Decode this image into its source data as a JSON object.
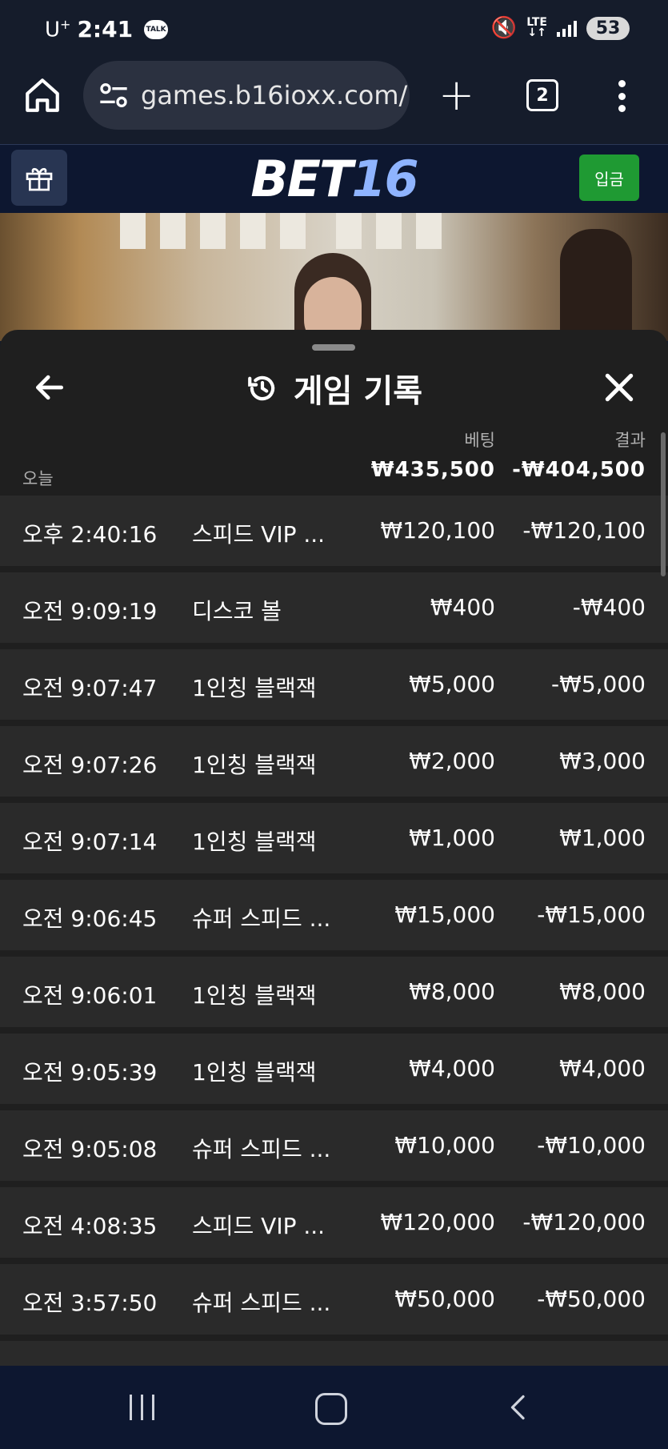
{
  "status_bar": {
    "carrier": "U",
    "carrier_sup": "+",
    "time": "2:41",
    "talk_badge": "TALK",
    "network": "LTE",
    "battery": "53"
  },
  "browser": {
    "url": "games.b16ioxx.com/",
    "tab_count": "2"
  },
  "site": {
    "logo_part1": "BET",
    "logo_part2": "16",
    "deposit_label": "입금"
  },
  "history": {
    "title": "게임 기록",
    "col_bet": "베팅",
    "col_result": "결과",
    "day_label": "오늘",
    "total_bet": "₩435,500",
    "total_result": "-₩404,500",
    "rows": [
      {
        "time": "오후 2:40:16",
        "game": "스피드 VIP ...",
        "bet": "₩120,100",
        "result": "-₩120,100"
      },
      {
        "time": "오전 9:09:19",
        "game": "디스코 볼",
        "bet": "₩400",
        "result": "-₩400"
      },
      {
        "time": "오전 9:07:47",
        "game": "1인칭 블랙잭",
        "bet": "₩5,000",
        "result": "-₩5,000"
      },
      {
        "time": "오전 9:07:26",
        "game": "1인칭 블랙잭",
        "bet": "₩2,000",
        "result": "₩3,000"
      },
      {
        "time": "오전 9:07:14",
        "game": "1인칭 블랙잭",
        "bet": "₩1,000",
        "result": "₩1,000"
      },
      {
        "time": "오전 9:06:45",
        "game": "슈퍼 스피드 ...",
        "bet": "₩15,000",
        "result": "-₩15,000"
      },
      {
        "time": "오전 9:06:01",
        "game": "1인칭 블랙잭",
        "bet": "₩8,000",
        "result": "₩8,000"
      },
      {
        "time": "오전 9:05:39",
        "game": "1인칭 블랙잭",
        "bet": "₩4,000",
        "result": "₩4,000"
      },
      {
        "time": "오전 9:05:08",
        "game": "슈퍼 스피드 ...",
        "bet": "₩10,000",
        "result": "-₩10,000"
      },
      {
        "time": "오전 4:08:35",
        "game": "스피드 VIP ...",
        "bet": "₩120,000",
        "result": "-₩120,000"
      },
      {
        "time": "오전 3:57:50",
        "game": "슈퍼 스피드 ...",
        "bet": "₩50,000",
        "result": "-₩50,000"
      }
    ]
  },
  "icons": {
    "home": "home-icon",
    "site_settings": "tune-icon",
    "new_tab": "plus-icon",
    "tabs": "tabs-icon",
    "menu": "more-vert-icon",
    "gift": "gift-icon",
    "back": "arrow-left-icon",
    "history": "history-icon",
    "close": "close-icon"
  },
  "colors": {
    "page_bg": "#151c2b",
    "site_header": "#0d1730",
    "deposit_button": "#1f9a33",
    "sheet_bg": "#1f1f1f",
    "row_bg": "#2a2a2a",
    "logo_accent": "#8fb4ff"
  }
}
